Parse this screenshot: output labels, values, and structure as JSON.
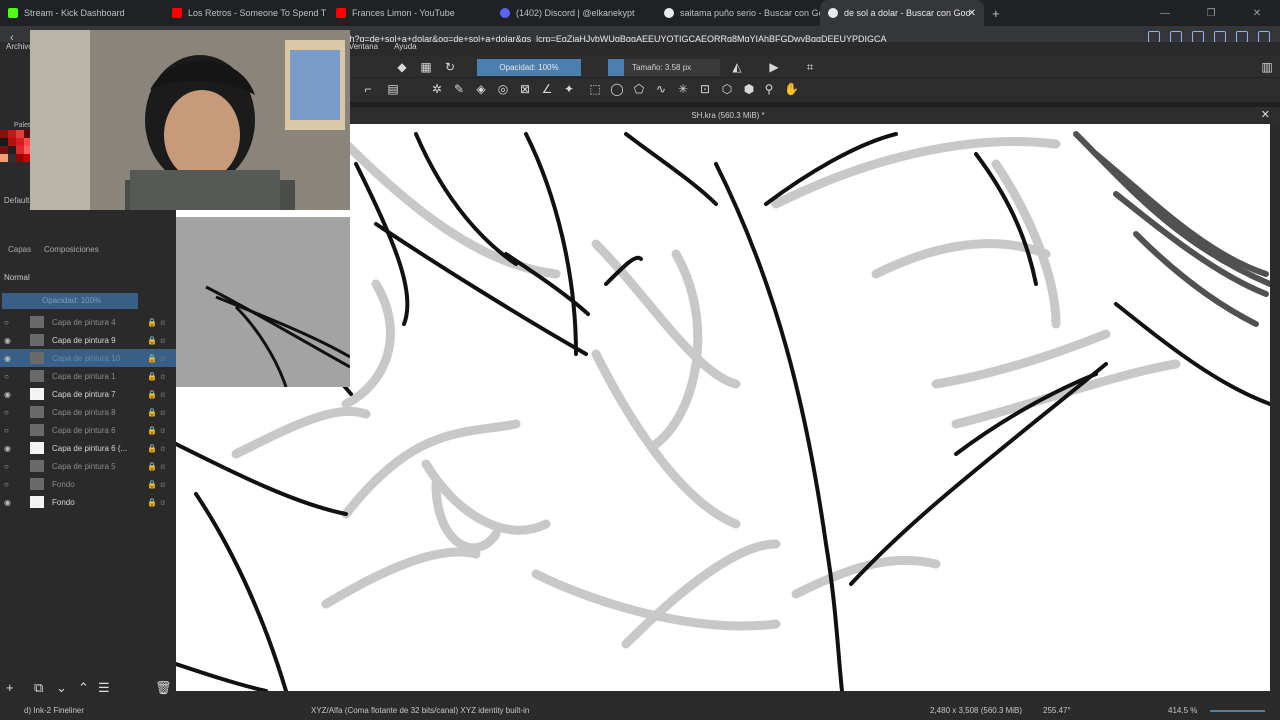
{
  "browser": {
    "tabs": [
      {
        "title": "Stream - Kick Dashboard",
        "color": "#53fc18"
      },
      {
        "title": "Los Retros - Someone To Spend T",
        "color": "#ff0000"
      },
      {
        "title": "Frances Limon - YouTube",
        "color": "#ff0000"
      },
      {
        "title": "(1402) Discord | @elkanekypt",
        "color": "#5865f2"
      },
      {
        "title": "saitama puño serio - Buscar con Goo",
        "color": "#e8eaed"
      },
      {
        "title": "de sol a dolar - Buscar con Goo",
        "color": "#e8eaed"
      }
    ],
    "url": "ch?q=de+sol+a+dolar&oq=de+sol+a+dolar&gs_lcrp=EgZjaHJvbWUqBggAEEUYOTIGCAEQRRg8MgYIAhBFGDwyBggDEEUYPDIGCA"
  },
  "app": {
    "menu": [
      "Archivo",
      "Ventana",
      "Ayuda"
    ],
    "opacity_label": "Opacidad: 100%",
    "size_label": "Tamaño: 3.58 px",
    "doc_title": "SH.kra (560.3 MiB) *",
    "panel_tab": "Composiciones",
    "panel_label_capas": "Capas",
    "blend_mode": "Normal",
    "layer_opacity": "Opacidad: 100%",
    "layers": [
      {
        "name": "Capa de pintura 4",
        "state": "hidden"
      },
      {
        "name": "Capa de pintura 9",
        "state": "visible"
      },
      {
        "name": "Capa de pintura 10",
        "state": "selected"
      },
      {
        "name": "Capa de pintura 1",
        "state": "hidden"
      },
      {
        "name": "Capa de pintura 7",
        "state": "visible"
      },
      {
        "name": "Capa de pintura 8",
        "state": "hidden"
      },
      {
        "name": "Capa de pintura 6",
        "state": "hidden"
      },
      {
        "name": "Capa de pintura 6 (...",
        "state": "visible"
      },
      {
        "name": "Capa de pintura 5",
        "state": "hidden"
      },
      {
        "name": "Fondo",
        "state": "hidden"
      },
      {
        "name": "Fondo",
        "state": "visible"
      }
    ],
    "status": {
      "brush": "d) Ink-2 Fineliner",
      "colorspace": "XYZ/Alfa (Coma flotante de 32 bits/canal)  XYZ identity built-in",
      "dimensions": "2,480 x 3,508 (560.3 MiB)",
      "rotation": "255.47°",
      "zoom": "414.5 %"
    },
    "left_labels": {
      "default": "Default",
      "paleta": "Palet"
    }
  }
}
